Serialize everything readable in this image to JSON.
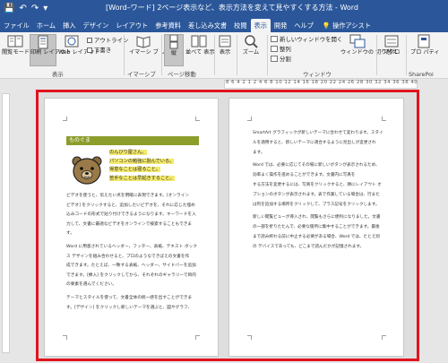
{
  "window": {
    "title": "[Word–ワード] 2ページ表示など、表示方法を変えて見やすくする方法 - Word"
  },
  "qat": {
    "save": "💾",
    "undo": "↶",
    "redo": "↷",
    "more": "▾"
  },
  "tabs": [
    {
      "label": "ファイル"
    },
    {
      "label": "ホーム"
    },
    {
      "label": "挿入"
    },
    {
      "label": "デザイン"
    },
    {
      "label": "レイアウト"
    },
    {
      "label": "参考資料"
    },
    {
      "label": "差し込み文書"
    },
    {
      "label": "校閲"
    },
    {
      "label": "表示"
    },
    {
      "label": "開発"
    },
    {
      "label": "ヘルプ"
    }
  ],
  "tell_me": "操作アシスト",
  "colors": {
    "titlebar": "#2b579a",
    "heading": "#8c9d2c",
    "highlight": "#f3e96b",
    "frame": "#e0141f"
  },
  "ribbon": {
    "views": {
      "read_mode": "閲覧モード",
      "print_layout": "印刷 レイアウト",
      "web_layout": "Web レイアウト",
      "outline": "アウトライン",
      "draft": "下書き",
      "label": "表示"
    },
    "immersive": {
      "reader": "イマーシ ブ リーダー",
      "label": "イマーシブ"
    },
    "page_move": {
      "vertical": "縦",
      "side_by_side": "並べて 表示",
      "label": "ページ移動"
    },
    "show": {
      "label": "表示"
    },
    "zoom": {
      "label": "ズーム"
    },
    "window": {
      "new_window": "新しいウィンドウを開く",
      "arrange": "整列",
      "split": "分割",
      "switch": "ウィンドウの 切り替え",
      "label": "ウィンドウ"
    },
    "macro": {
      "label": "マクロ"
    },
    "sharepoint": {
      "props": "プロ パティ",
      "label": "SharePoi"
    }
  },
  "ruler": {
    "marks": "8 6 4 2 1 2 4 6 8 10 12 14 16 18 20 22 24 26 28 30 32 34 36 38 40"
  },
  "page1": {
    "heading": "ものぐま",
    "hl1": "のんびり屋さん。",
    "hl2": "パソコンの勉強に励んでいる。",
    "hl3": "得意なことは寝ること。",
    "hl4": "苦手なことは早起きすること。",
    "lines": [
      "ビデオを使うと、伝えたい点を明確に表現できます。[オンライン",
      "ビデオ] をクリックすると、追加したいビデオを、それに応じた埋め",
      "込みコードの形式で貼り付けできるようになります。キーワードを入",
      "力して、文書に最適なビデオをオンラインで検索することもできま",
      "す。",
      "Word に用意されているヘッダー、フッター、表紙、テキスト ボック",
      "ス デザインを組み合わせると、プロのようなできばえの文書を作",
      "成できます。たとえば、一致する表紙、ヘッダー、サイドバーを追加",
      "できます。[挿入] をクリックしてから、それぞれのギャラリーで目的",
      "の要素を選んでください。",
      "テーマとスタイルを使って、文書全体の統一感を出すことができま",
      "す。[デザイン] をクリックし新しいテーマを選ぶと、図やグラフ、"
    ]
  },
  "page2": {
    "lines": [
      "SmartArt グラフィックが新しいテーマに合わせて変わります。スタイ",
      "ルを適用すると、新しいテーマに適合するように見出しが変更され",
      "ます。",
      "Word では、必要に応じてその場に新しいボタンが表示されるため、",
      "効率よく操作を進めることができます。文書内に写真を",
      "する方法を変更するには、写真をクリックすると、隣にレイアウト オ",
      "プションのボタンが表示されます。表で作業している場合は、行また",
      "は列を追加する場所をクリックして、プラス記号をクリックします。",
      "新しい閲覧ビューが導入され、閲覧もさらに便利になりました。文書",
      "の一部を折りたたんで、必要な箇所に集中することができます。最後",
      "まで読み終わる前に中止する必要がある場合、Word では、たとえ別",
      "の デバイスであっても、どこまで読んだかが記憶されます。"
    ]
  }
}
